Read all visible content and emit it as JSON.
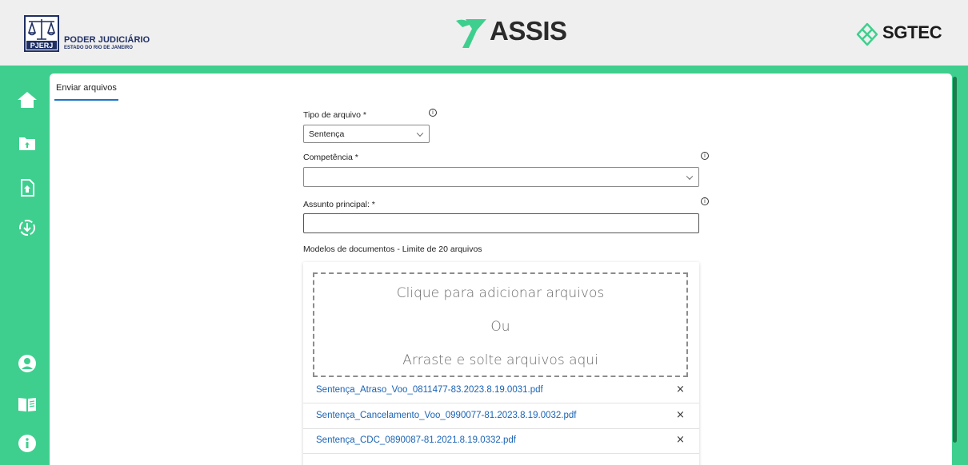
{
  "header": {
    "org_title": "PODER JUDICIÁRIO",
    "org_subtitle": "ESTADO DO RIO DE JANEIRO",
    "pjerj_badge": "PJERJ",
    "app_name": "ASSIS",
    "partner_name": "SGTEC",
    "brand_color": "#3ecf8e"
  },
  "sidebar": {
    "items": [
      {
        "icon": "home-icon"
      },
      {
        "icon": "folder-upload-icon"
      },
      {
        "icon": "file-upload-icon"
      },
      {
        "icon": "download-circle-icon"
      },
      {
        "icon": "user-icon"
      },
      {
        "icon": "book-icon"
      },
      {
        "icon": "info-icon"
      }
    ]
  },
  "tabs": [
    {
      "label": "Enviar arquivos",
      "active": true
    }
  ],
  "form": {
    "file_type": {
      "label": "Tipo de arquivo *",
      "value": "Sentença"
    },
    "competence": {
      "label": "Competência *",
      "value": ""
    },
    "main_subject": {
      "label": "Assunto principal: *",
      "value": ""
    },
    "models_label": "Modelos de documentos - Limite de 20 arquivos"
  },
  "dropzone": {
    "line1": "Clique para adicionar arquivos",
    "line2": "Ou",
    "line3": "Arraste e solte arquivos aqui"
  },
  "files": [
    {
      "name": "Sentença_Atraso_Voo_0811477-83.2023.8.19.0031.pdf"
    },
    {
      "name": "Sentença_Cancelamento_Voo_0990077-81.2023.8.19.0032.pdf"
    },
    {
      "name": "Sentença_CDC_0890087-81.2021.8.19.0332.pdf"
    }
  ],
  "close_glyph": "×",
  "info_glyph": "i"
}
